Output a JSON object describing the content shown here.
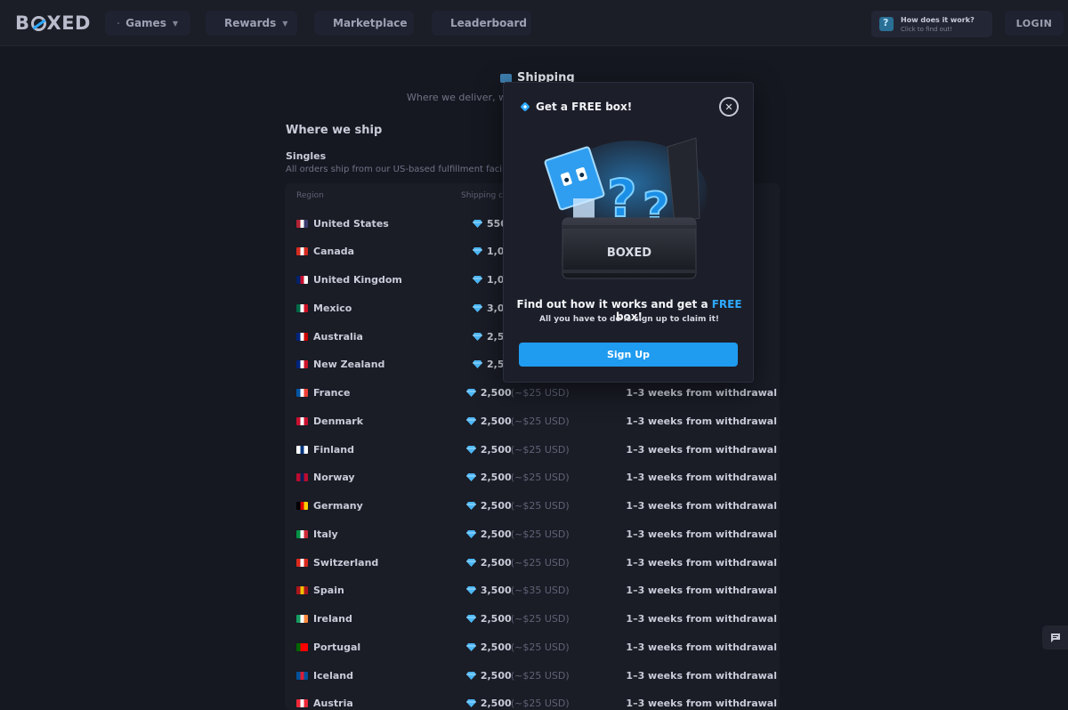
{
  "header": {
    "logo_text_b": "B",
    "logo_text_rest": "XED",
    "nav": [
      {
        "label": "Games",
        "icon": "gamepad-icon",
        "has_dropdown": true
      },
      {
        "label": "Rewards",
        "icon": "gift-icon",
        "has_dropdown": true
      },
      {
        "label": "Marketplace",
        "icon": "store-icon",
        "has_dropdown": false
      },
      {
        "label": "Leaderboard",
        "icon": "trophy-icon",
        "has_dropdown": false
      }
    ],
    "how_it_works": {
      "title": "How does it work?",
      "subtitle": "Click to find out!"
    },
    "login_label": "LOGIN"
  },
  "page": {
    "title": "Shipping",
    "subtitle": "Where we deliver, wh",
    "section_title": "Where we ship",
    "singles_title": "Singles",
    "singles_desc": "All orders ship from our US-based fulfillment facili",
    "columns": {
      "region": "Region",
      "cost": "Shipping c"
    }
  },
  "rows": [
    {
      "country": "United States",
      "cost": "550",
      "usd": "(",
      "delivery": ""
    },
    {
      "country": "Canada",
      "cost": "1,000",
      "usd": "",
      "delivery": ""
    },
    {
      "country": "United Kingdom",
      "cost": "1,000",
      "usd": "",
      "delivery": ""
    },
    {
      "country": "Mexico",
      "cost": "3,000",
      "usd": "",
      "delivery": ""
    },
    {
      "country": "Australia",
      "cost": "2,500",
      "usd": "",
      "delivery": ""
    },
    {
      "country": "New Zealand",
      "cost": "2,500",
      "usd": "",
      "delivery": ""
    },
    {
      "country": "France",
      "cost": "2,500",
      "usd": "(~$25 USD)",
      "delivery": "1–3 weeks from withdrawal"
    },
    {
      "country": "Denmark",
      "cost": "2,500",
      "usd": "(~$25 USD)",
      "delivery": "1–3 weeks from withdrawal"
    },
    {
      "country": "Finland",
      "cost": "2,500",
      "usd": "(~$25 USD)",
      "delivery": "1–3 weeks from withdrawal"
    },
    {
      "country": "Norway",
      "cost": "2,500",
      "usd": "(~$25 USD)",
      "delivery": "1–3 weeks from withdrawal"
    },
    {
      "country": "Germany",
      "cost": "2,500",
      "usd": "(~$25 USD)",
      "delivery": "1–3 weeks from withdrawal"
    },
    {
      "country": "Italy",
      "cost": "2,500",
      "usd": "(~$25 USD)",
      "delivery": "1–3 weeks from withdrawal"
    },
    {
      "country": "Switzerland",
      "cost": "2,500",
      "usd": "(~$25 USD)",
      "delivery": "1–3 weeks from withdrawal"
    },
    {
      "country": "Spain",
      "cost": "3,500",
      "usd": "(~$35 USD)",
      "delivery": "1–3 weeks from withdrawal"
    },
    {
      "country": "Ireland",
      "cost": "2,500",
      "usd": "(~$25 USD)",
      "delivery": "1–3 weeks from withdrawal"
    },
    {
      "country": "Portugal",
      "cost": "2,500",
      "usd": "(~$25 USD)",
      "delivery": "1–3 weeks from withdrawal"
    },
    {
      "country": "Iceland",
      "cost": "2,500",
      "usd": "(~$25 USD)",
      "delivery": "1–3 weeks from withdrawal"
    },
    {
      "country": "Austria",
      "cost": "2,500",
      "usd": "(~$25 USD)",
      "delivery": "1–3 weeks from withdrawal"
    }
  ],
  "flags": [
    [
      "#b22234",
      "#ffffff",
      "#3c3b6e"
    ],
    [
      "#d52b1e",
      "#ffffff",
      "#d52b1e"
    ],
    [
      "#012169",
      "#c8102e",
      "#ffffff"
    ],
    [
      "#006847",
      "#ffffff",
      "#ce1126"
    ],
    [
      "#00247d",
      "#ffffff",
      "#cc0000"
    ],
    [
      "#00247d",
      "#ffffff",
      "#cc142b"
    ],
    [
      "#0055a4",
      "#ffffff",
      "#ef4135"
    ],
    [
      "#c8102e",
      "#ffffff",
      "#c8102e"
    ],
    [
      "#ffffff",
      "#003580",
      "#ffffff"
    ],
    [
      "#ba0c2f",
      "#00205b",
      "#ba0c2f"
    ],
    [
      "#000000",
      "#dd0000",
      "#ffce00"
    ],
    [
      "#009246",
      "#ffffff",
      "#ce2b37"
    ],
    [
      "#da291c",
      "#ffffff",
      "#da291c"
    ],
    [
      "#aa151b",
      "#f1bf00",
      "#aa151b"
    ],
    [
      "#169b62",
      "#ffffff",
      "#ff883e"
    ],
    [
      "#006600",
      "#ff0000",
      "#ff0000"
    ],
    [
      "#02529c",
      "#dc1e35",
      "#02529c"
    ],
    [
      "#ed2939",
      "#ffffff",
      "#ed2939"
    ]
  ],
  "modal": {
    "title": "Get a FREE box!",
    "headline_pre": "Find out how it works and get a ",
    "headline_free": "FREE",
    "headline_post": " box!",
    "subline": "All you have to do is sign up to claim it!",
    "signup_label": "Sign Up",
    "box_brand": "BOXED",
    "close_symbol": "✕"
  },
  "colors": {
    "accent": "#1f9bf0",
    "free_text": "#2ea9ff",
    "background": "#161821"
  }
}
